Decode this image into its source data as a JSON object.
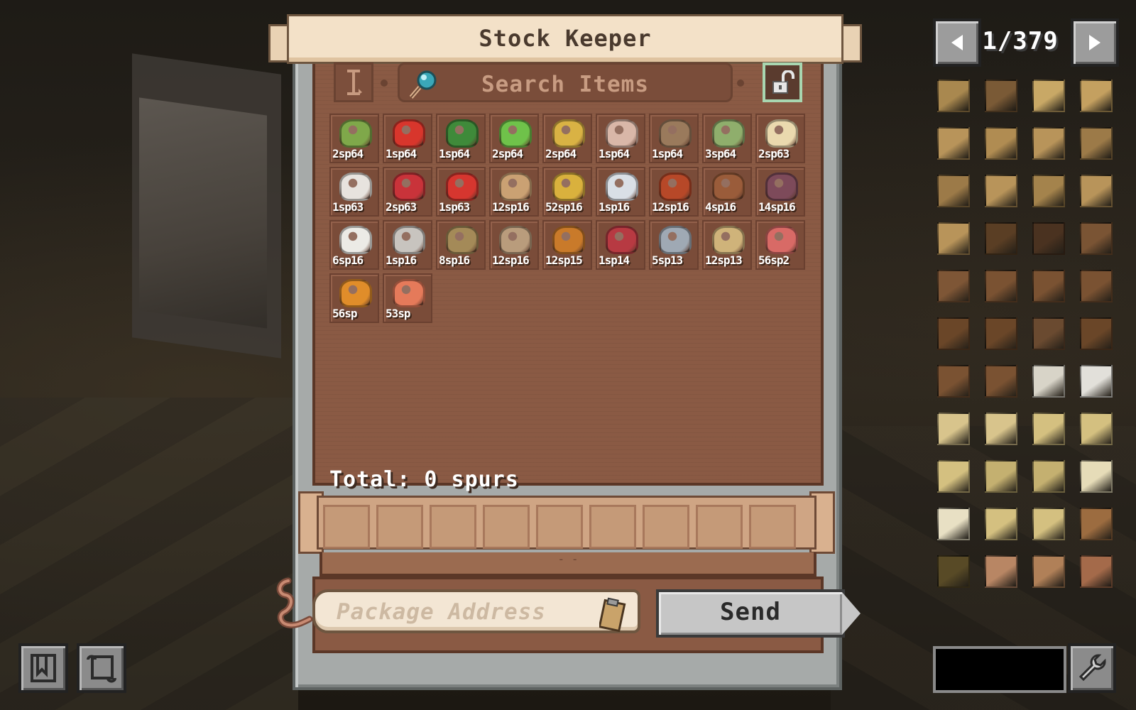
{
  "window": {
    "title": "Stock Keeper"
  },
  "search": {
    "placeholder": "Search Items",
    "mode_icon": "text-cursor-icon",
    "lock_icon": "unlocked-padlock-icon"
  },
  "items": [
    {
      "label": "2sp64",
      "color": "#7fa84a",
      "icon": "leek-icon"
    },
    {
      "label": "1sp64",
      "color": "#d8362c",
      "icon": "red-mushroom-icon"
    },
    {
      "label": "1sp64",
      "color": "#3f8a3a",
      "icon": "berry-bush-icon"
    },
    {
      "label": "2sp64",
      "color": "#6fc24a",
      "icon": "cabbage-icon"
    },
    {
      "label": "2sp64",
      "color": "#d9b244",
      "icon": "rice-panicle-icon"
    },
    {
      "label": "1sp64",
      "color": "#d9b7a8",
      "icon": "pink-mushroom-icon"
    },
    {
      "label": "1sp64",
      "color": "#9a7a5c",
      "icon": "brown-mushroom-icon"
    },
    {
      "label": "3sp64",
      "color": "#8fae6c",
      "icon": "flowers-icon"
    },
    {
      "label": "2sp63",
      "color": "#ead9ae",
      "icon": "dough-icon"
    },
    {
      "label": "1sp63",
      "color": "#e7e3de",
      "icon": "flour-icon"
    },
    {
      "label": "2sp63",
      "color": "#c9333a",
      "icon": "raw-meat-icon"
    },
    {
      "label": "1sp63",
      "color": "#d6362f",
      "icon": "tomato-icon"
    },
    {
      "label": "12sp16",
      "color": "#caa173",
      "icon": "pasta-bowl-icon"
    },
    {
      "label": "52sp16",
      "color": "#d9b13d",
      "icon": "golden-dish-icon"
    },
    {
      "label": "1sp16",
      "color": "#d9dfe6",
      "icon": "milk-bottle-icon"
    },
    {
      "label": "12sp16",
      "color": "#b74828",
      "icon": "stew-bowl-icon"
    },
    {
      "label": "4sp16",
      "color": "#9a5c3a",
      "icon": "roast-platter-icon"
    },
    {
      "label": "14sp16",
      "color": "#7d4a5a",
      "icon": "feast-platter-icon"
    },
    {
      "label": "6sp16",
      "color": "#ecebe6",
      "icon": "rice-bowl-icon"
    },
    {
      "label": "1sp16",
      "color": "#c8c4bf",
      "icon": "jar-icon"
    },
    {
      "label": "8sp16",
      "color": "#a48a58",
      "icon": "drumstick-plate-icon"
    },
    {
      "label": "12sp16",
      "color": "#b99c7c",
      "icon": "salad-bowl-icon"
    },
    {
      "label": "12sp15",
      "color": "#c97a2a",
      "icon": "pumpkin-basket-icon"
    },
    {
      "label": "1sp14",
      "color": "#b73a42",
      "icon": "berry-jam-icon"
    },
    {
      "label": "5sp13",
      "color": "#9fa9b4",
      "icon": "cocoa-mug-icon"
    },
    {
      "label": "12sp13",
      "color": "#cfb37a",
      "icon": "sandwich-icon"
    },
    {
      "label": "56sp2",
      "color": "#d86a66",
      "icon": "ham-platter-icon"
    },
    {
      "label": "56sp",
      "color": "#e08d2a",
      "icon": "pumpkin-pie-icon"
    },
    {
      "label": "53sp",
      "color": "#e57a5a",
      "icon": "sushi-platter-icon"
    }
  ],
  "total": {
    "text": "Total: 0 spurs"
  },
  "order": {
    "slot_count": 9,
    "handle": "- -"
  },
  "address": {
    "placeholder": "Package Address",
    "icon": "clipboard-icon"
  },
  "send": {
    "label": "Send"
  },
  "jei": {
    "page": "1/379",
    "prev_icon": "triangle-left-icon",
    "next_icon": "triangle-right-icon",
    "search_value": "",
    "settings_icon": "wrench-icon",
    "items": [
      {
        "name": "oak-log-icon",
        "color": "#a9884f"
      },
      {
        "name": "oak-wood-icon",
        "color": "#7a5a36"
      },
      {
        "name": "stripped-oak-log-icon",
        "color": "#c8a866"
      },
      {
        "name": "stripped-oak-wood-icon",
        "color": "#c4a060"
      },
      {
        "name": "oak-planks-icon",
        "color": "#b8945a"
      },
      {
        "name": "oak-stairs-icon",
        "color": "#b08c52"
      },
      {
        "name": "oak-slab-icon",
        "color": "#b8945a"
      },
      {
        "name": "oak-fence-icon",
        "color": "#9c7a48"
      },
      {
        "name": "oak-fence-gate-icon",
        "color": "#9c7a48"
      },
      {
        "name": "oak-door-icon",
        "color": "#b8945a"
      },
      {
        "name": "oak-trapdoor-icon",
        "color": "#a4834c"
      },
      {
        "name": "oak-pressure-plate-icon",
        "color": "#b8945a"
      },
      {
        "name": "oak-button-icon",
        "color": "#b8945a"
      },
      {
        "name": "spruce-log-icon",
        "color": "#5a3e24"
      },
      {
        "name": "spruce-wood-icon",
        "color": "#4a3220"
      },
      {
        "name": "stripped-spruce-log-icon",
        "color": "#7a5434"
      },
      {
        "name": "spruce-planks-icon",
        "color": "#7e5636"
      },
      {
        "name": "spruce-planks-block-icon",
        "color": "#7a5232"
      },
      {
        "name": "spruce-stairs-icon",
        "color": "#7a5232"
      },
      {
        "name": "spruce-slab-icon",
        "color": "#7a5232"
      },
      {
        "name": "spruce-fence-icon",
        "color": "#6a4628"
      },
      {
        "name": "spruce-fence-gate-icon",
        "color": "#6a4628"
      },
      {
        "name": "spruce-door-icon",
        "color": "#6a4a30"
      },
      {
        "name": "spruce-trapdoor-icon",
        "color": "#6a4628"
      },
      {
        "name": "spruce-pressure-plate-icon",
        "color": "#7a5232"
      },
      {
        "name": "spruce-button-icon",
        "color": "#7a5232"
      },
      {
        "name": "birch-log-icon",
        "color": "#d8d4c8"
      },
      {
        "name": "birch-wood-icon",
        "color": "#e2e0da"
      },
      {
        "name": "stripped-birch-log-icon",
        "color": "#d8c48c"
      },
      {
        "name": "stripped-birch-wood-icon",
        "color": "#d8c48c"
      },
      {
        "name": "birch-planks-icon",
        "color": "#d4c080"
      },
      {
        "name": "birch-stairs-icon",
        "color": "#d4c080"
      },
      {
        "name": "birch-slab-icon",
        "color": "#d4c080"
      },
      {
        "name": "birch-fence-icon",
        "color": "#c4b070"
      },
      {
        "name": "birch-fence-gate-icon",
        "color": "#c4b070"
      },
      {
        "name": "birch-door-icon",
        "color": "#e6dcb8"
      },
      {
        "name": "birch-trapdoor-icon",
        "color": "#e8e0c4"
      },
      {
        "name": "birch-pressure-plate-icon",
        "color": "#d4c080"
      },
      {
        "name": "birch-button-icon",
        "color": "#d4c080"
      },
      {
        "name": "jungle-log-icon",
        "color": "#9c6c40"
      },
      {
        "name": "jungle-wood-icon",
        "color": "#584a26"
      },
      {
        "name": "stripped-jungle-log-icon",
        "color": "#b88664"
      },
      {
        "name": "stripped-jungle-wood-icon",
        "color": "#b08058"
      },
      {
        "name": "jungle-planks-icon",
        "color": "#a46a4a"
      }
    ]
  }
}
